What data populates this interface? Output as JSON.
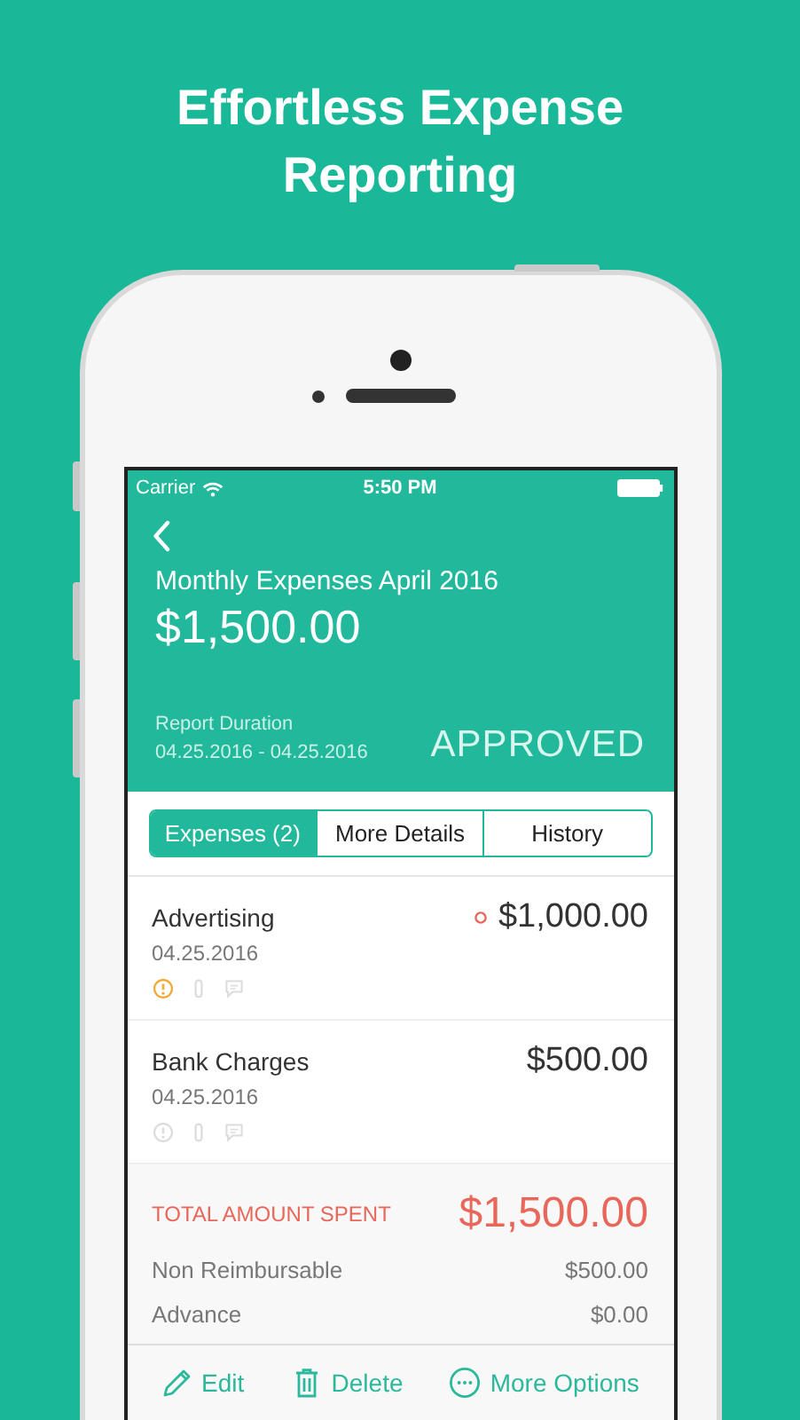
{
  "headline": "Effortless Expense Reporting",
  "status_bar": {
    "carrier": "Carrier",
    "time": "5:50 PM"
  },
  "report": {
    "title": "Monthly Expenses April 2016",
    "amount": "$1,500.00",
    "duration_label": "Report Duration",
    "duration": "04.25.2016 - 04.25.2016",
    "status": "APPROVED"
  },
  "tabs": [
    {
      "label": "Expenses (2)",
      "selected": true
    },
    {
      "label": "More Details",
      "selected": false
    },
    {
      "label": "History",
      "selected": false
    }
  ],
  "expenses": [
    {
      "name": "Advertising",
      "date": "04.25.2016",
      "amount": "$1,000.00",
      "warning": true,
      "flagged": true
    },
    {
      "name": "Bank Charges",
      "date": "04.25.2016",
      "amount": "$500.00",
      "warning": false,
      "flagged": false
    }
  ],
  "summary": {
    "total_label": "TOTAL AMOUNT SPENT",
    "total": "$1,500.00",
    "lines": [
      {
        "label": "Non Reimbursable",
        "value": "$500.00"
      },
      {
        "label": "Advance",
        "value": "$0.00"
      }
    ]
  },
  "actions": [
    {
      "kind": "edit",
      "label": "Edit"
    },
    {
      "kind": "delete",
      "label": "Delete"
    },
    {
      "kind": "more",
      "label": "More Options"
    }
  ]
}
